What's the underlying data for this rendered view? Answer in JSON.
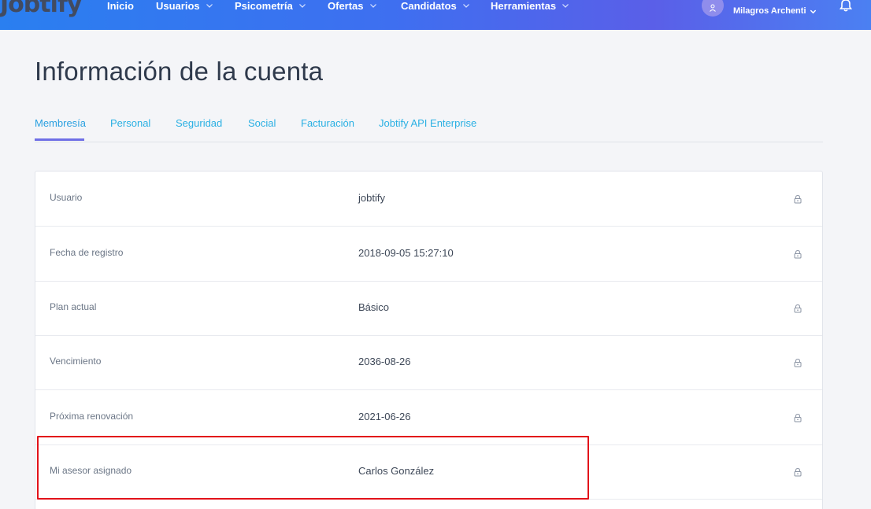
{
  "app": {
    "logo_text": "Jobtify"
  },
  "nav": {
    "items": [
      {
        "label": "Inicio",
        "has_dropdown": false
      },
      {
        "label": "Usuarios",
        "has_dropdown": true
      },
      {
        "label": "Psicometría",
        "has_dropdown": true
      },
      {
        "label": "Ofertas",
        "has_dropdown": true
      },
      {
        "label": "Candidatos",
        "has_dropdown": true
      },
      {
        "label": "Herramientas",
        "has_dropdown": true
      }
    ],
    "user_name": "Milagros Archenti",
    "icons": {
      "avatar": "user-icon",
      "user_menu": "chevron-down-icon",
      "notifications": "bell-icon"
    }
  },
  "page": {
    "title": "Información de la cuenta"
  },
  "tabs": [
    {
      "label": "Membresía",
      "active": true
    },
    {
      "label": "Personal",
      "active": false
    },
    {
      "label": "Seguridad",
      "active": false
    },
    {
      "label": "Social",
      "active": false
    },
    {
      "label": "Facturación",
      "active": false
    },
    {
      "label": "Jobtify API Enterprise",
      "active": false
    }
  ],
  "membership": {
    "rows": [
      {
        "label": "Usuario",
        "value": "jobtify",
        "icon": "lock-icon"
      },
      {
        "label": "Fecha de registro",
        "value": "2018-09-05 15:27:10",
        "icon": "lock-icon"
      },
      {
        "label": "Plan actual",
        "value": "Básico",
        "icon": "lock-icon"
      },
      {
        "label": "Vencimiento",
        "value": "2036-08-26",
        "icon": "lock-icon"
      },
      {
        "label": "Próxima renovación",
        "value": "2021-06-26",
        "icon": "lock-icon"
      },
      {
        "label": "Mi asesor asignado",
        "value": "Carlos González",
        "icon": "lock-icon"
      }
    ]
  },
  "colors": {
    "accent": "#2ab0e3",
    "tab_underline": "#6f6fe6",
    "highlight": "#e2121a",
    "nav_gradient_start": "#2a7ff0",
    "nav_gradient_end": "#4b80f2"
  }
}
